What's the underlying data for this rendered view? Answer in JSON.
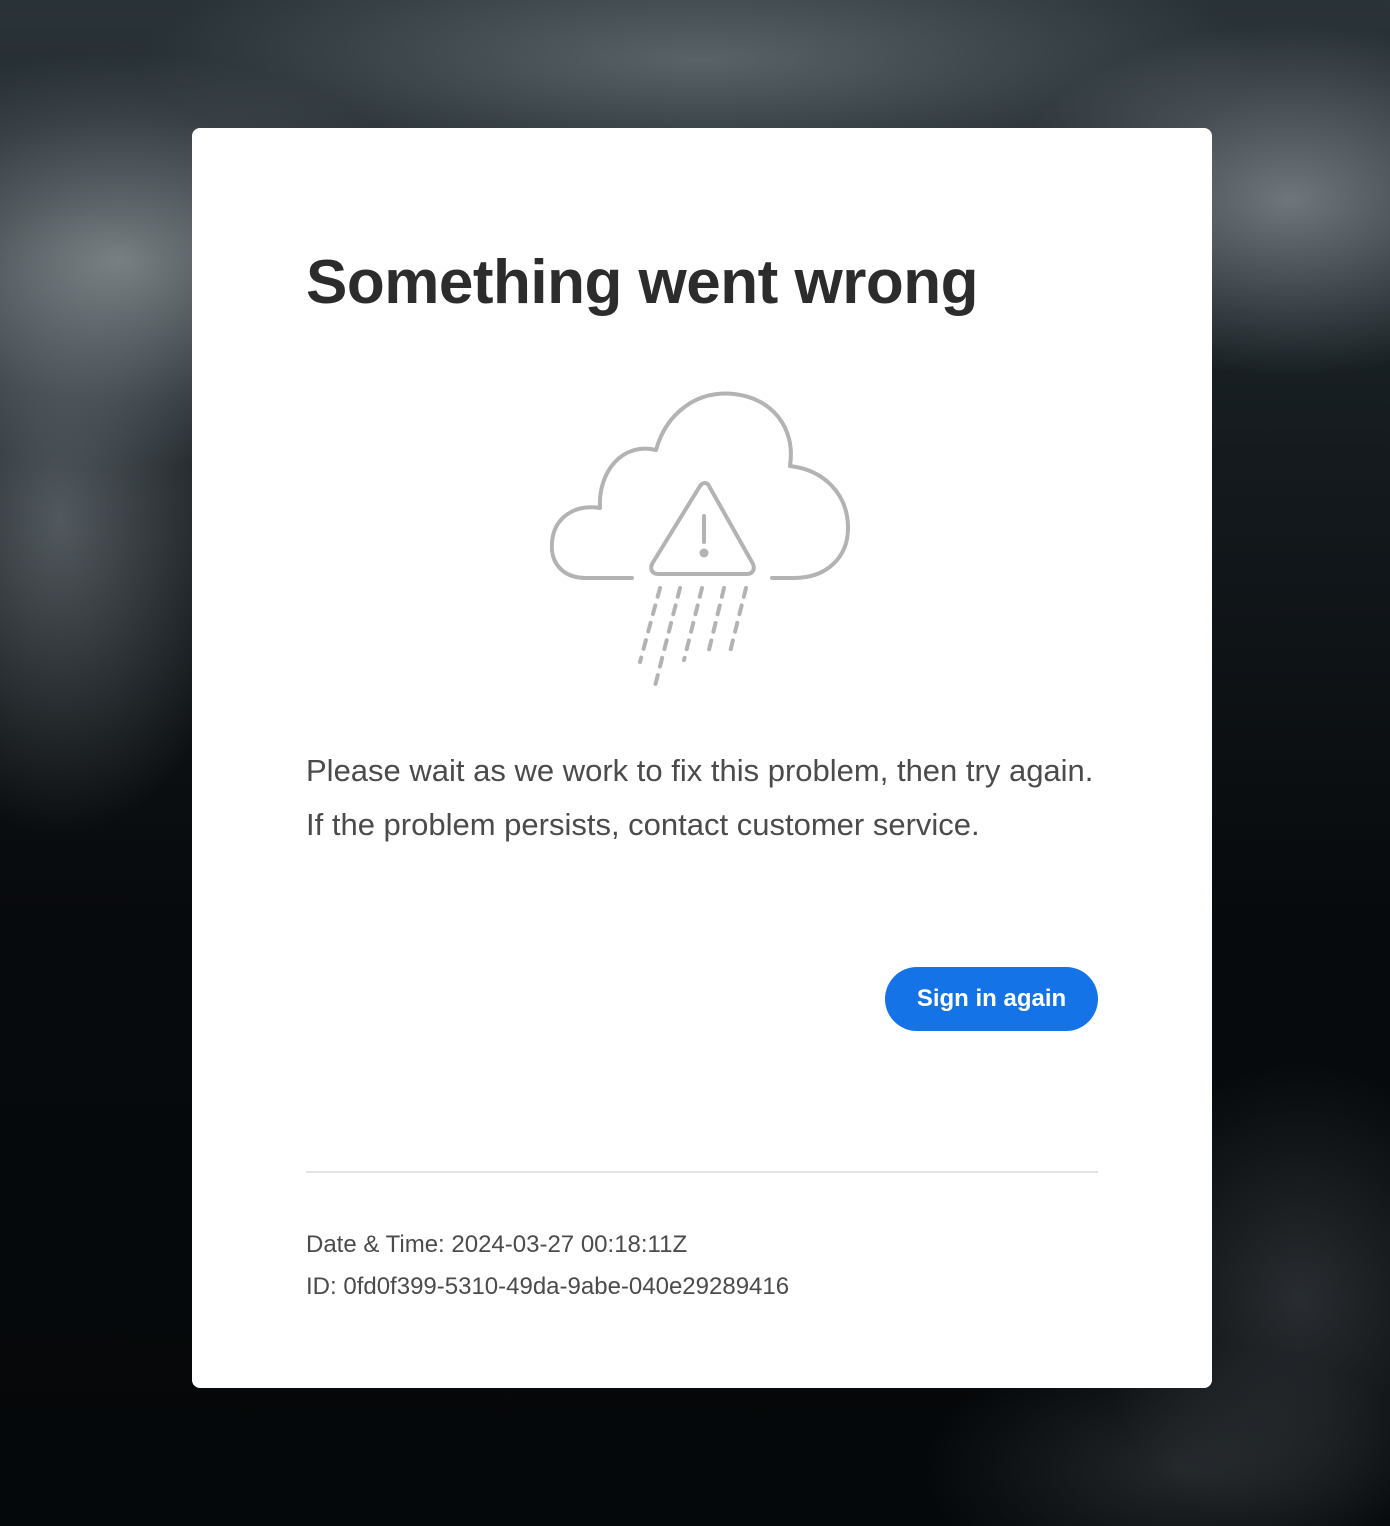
{
  "error_card": {
    "title": "Something went wrong",
    "illustration_icon": "cloud-warning-rain-icon",
    "message": "Please wait as we work to fix this problem, then try again. If the problem persists, contact customer service.",
    "button_label": "Sign in again",
    "datetime_label": "Date & Time:",
    "datetime_value": "2024-03-27 00:18:11Z",
    "id_label": "ID:",
    "id_value": "0fd0f399-5310-49da-9abe-040e29289416"
  },
  "colors": {
    "accent": "#1473e6",
    "title_text": "#2c2c2c",
    "body_text": "#4b4b4b",
    "illustration_stroke": "#b3b3b3"
  }
}
